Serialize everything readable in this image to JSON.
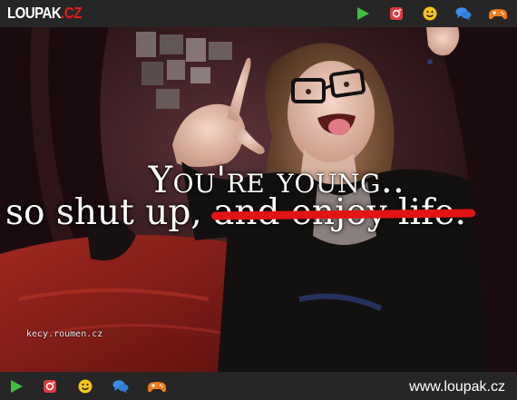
{
  "header": {
    "logo_main": "LOUPAK",
    "logo_tld": ".CZ",
    "icons": [
      "play-icon",
      "instagram-icon",
      "smiley-icon",
      "chat-icon",
      "gamepad-icon"
    ]
  },
  "image": {
    "text_line1": "You're young..",
    "text_line2_before": "so shut up,",
    "text_line2_struck": "and enjoy life.",
    "watermark": "kecy.roumen.cz"
  },
  "footer": {
    "icons": [
      "play-icon",
      "instagram-icon",
      "smiley-icon",
      "chat-icon",
      "gamepad-icon"
    ],
    "site_url": "www.loupak.cz"
  },
  "colors": {
    "bar": "#262626",
    "play": "#3fbf3f",
    "instagram": "#e03a3e",
    "smiley": "#f5c518",
    "chat": "#3a8ee6",
    "gamepad": "#f07a1a",
    "strike": "#e11414"
  }
}
